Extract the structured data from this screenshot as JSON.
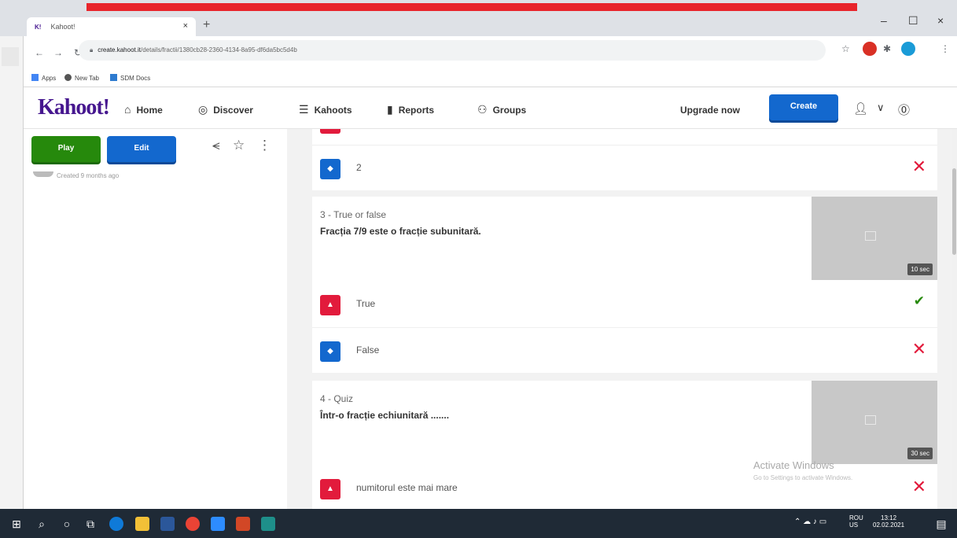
{
  "browser": {
    "tab_title": "Kahoot!",
    "tab_favicon": "K!",
    "tab_close": "×",
    "new_tab": "+",
    "url_host": "create.kahoot.it",
    "url_path": "/details/fractii/1380cb28-2360-4134-8a95-df6da5bc5d4b",
    "bookmarks": [
      "Apps",
      "New Tab",
      "SDM Docs"
    ],
    "window_controls": [
      "–",
      "☐",
      "×"
    ]
  },
  "header": {
    "logo": "Kahoot!",
    "nav": [
      {
        "icon": "⌂",
        "label": "Home"
      },
      {
        "icon": "◎",
        "label": "Discover"
      },
      {
        "icon": "☰",
        "label": "Kahoots"
      },
      {
        "icon": "▮",
        "label": "Reports"
      },
      {
        "icon": "⚇",
        "label": "Groups"
      }
    ],
    "upgrade": "Upgrade now",
    "create": "Create"
  },
  "left": {
    "play": "Play",
    "edit": "Edit",
    "created": "Created 9 months ago"
  },
  "questions": {
    "prev_answer": {
      "text": "2",
      "correct": false
    },
    "q3": {
      "type": "3 - True or false",
      "title": "Fracția 7/9 este o fracție subunitară.",
      "time": "10 sec",
      "answers": [
        {
          "text": "True",
          "correct": true
        },
        {
          "text": "False",
          "correct": false
        }
      ]
    },
    "q4": {
      "type": "4 - Quiz",
      "title": "Într-o fracție echiunitară .......",
      "time": "30 sec",
      "answers": [
        {
          "text": "numitorul este mai mare",
          "correct": false
        }
      ]
    }
  },
  "watermark": {
    "line1": "Activate Windows",
    "line2": "Go to Settings to activate Windows."
  },
  "tray": {
    "lang": "ROU",
    "lang2": "US",
    "time": "13:12",
    "date": "02.02.2021"
  },
  "colors": {
    "kahoot_purple": "#46178f",
    "play_green": "#26890c",
    "edit_blue": "#1368ce",
    "answer_red": "#e21b3c"
  }
}
